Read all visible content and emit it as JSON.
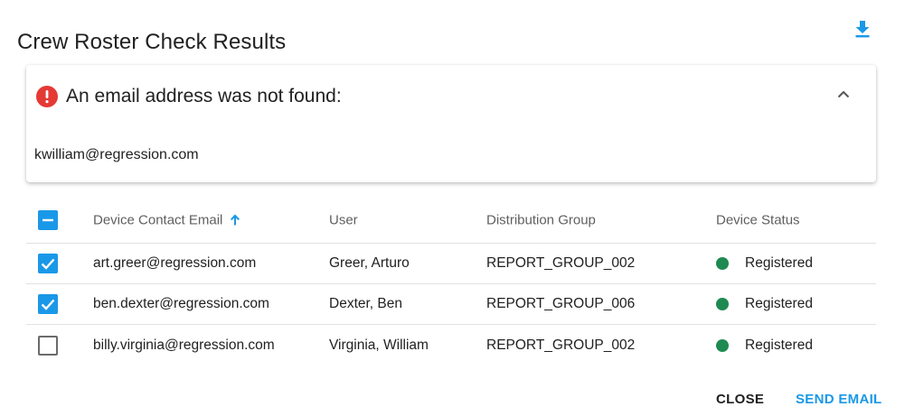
{
  "dialog": {
    "title": "Crew Roster Check Results",
    "download_icon": "download-icon"
  },
  "alert": {
    "icon": "error-icon",
    "icon_color": "#e53935",
    "title": "An email address was not found:",
    "missing_email": "kwilliam@regression.com",
    "collapse_icon": "chevron-up-icon"
  },
  "table": {
    "headers": {
      "email": "Device Contact Email",
      "user": "User",
      "group": "Distribution Group",
      "status": "Device Status"
    },
    "sort": {
      "column": "email",
      "direction": "ascending",
      "icon": "arrow-up-icon"
    },
    "select_all_state": "indeterminate",
    "rows": [
      {
        "checked": true,
        "email": "art.greer@regression.com",
        "user": "Greer, Arturo",
        "group": "REPORT_GROUP_002",
        "status": "Registered"
      },
      {
        "checked": true,
        "email": "ben.dexter@regression.com",
        "user": "Dexter, Ben",
        "group": "REPORT_GROUP_006",
        "status": "Registered"
      },
      {
        "checked": false,
        "email": "billy.virginia@regression.com",
        "user": "Virginia, William",
        "group": "REPORT_GROUP_002",
        "status": "Registered"
      }
    ]
  },
  "footer": {
    "close_label": "CLOSE",
    "send_label": "SEND EMAIL"
  },
  "colors": {
    "accent": "#1a98e8",
    "status_registered": "#1e8a51",
    "error": "#e53935"
  }
}
